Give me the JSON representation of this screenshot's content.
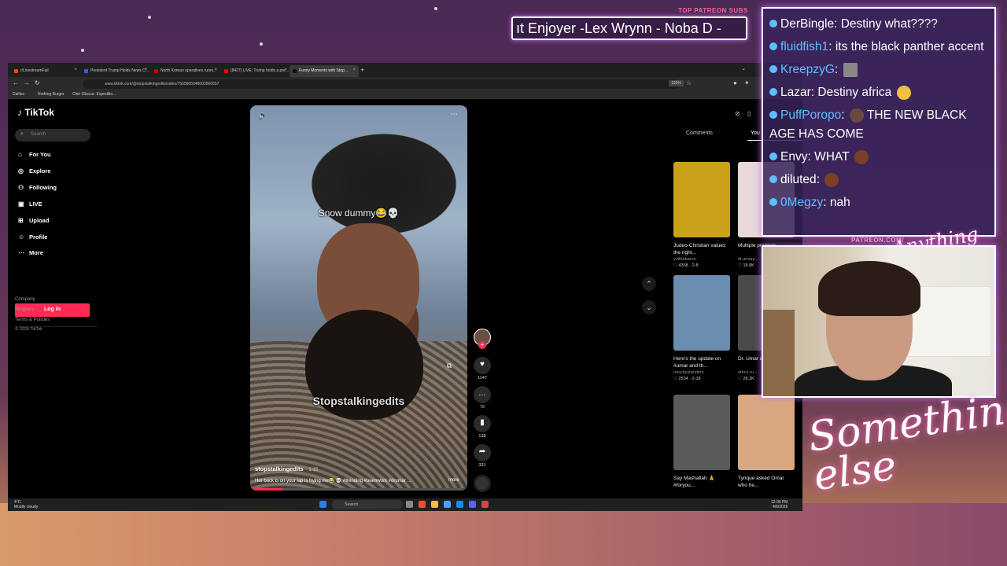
{
  "browser": {
    "tabs": [
      {
        "label": "r/LivestreamFail",
        "color": "#ff4500"
      },
      {
        "label": "President Trump Holds News C...",
        "color": "#3b5bdb"
      },
      {
        "label": "North Korean operatives runni...",
        "color": "#cc0000"
      },
      {
        "label": "(8427) LIVE: Trump holds a pre...",
        "color": "#ff0000"
      },
      {
        "label": "Funny Moments with Stop...",
        "color": "#111111"
      }
    ],
    "url": "www.tiktok.com/@stopstalkingedits/video/7555805646003560557",
    "zoom": "120%",
    "bookmarks": [
      "Dailies",
      "Nothing Burger",
      "Clair Obscur: Expeditio..."
    ]
  },
  "tiktok": {
    "logo": "TikTok",
    "search_placeholder": "Search",
    "nav": [
      {
        "label": "For You",
        "icon": "home-icon",
        "glyph": "⌂"
      },
      {
        "label": "Explore",
        "icon": "compass-icon",
        "glyph": "◎"
      },
      {
        "label": "Following",
        "icon": "people-icon",
        "glyph": "⚇"
      },
      {
        "label": "LIVE",
        "icon": "live-icon",
        "glyph": "▣"
      },
      {
        "label": "Upload",
        "icon": "upload-icon",
        "glyph": "⊞"
      },
      {
        "label": "Profile",
        "icon": "profile-icon",
        "glyph": "☺"
      },
      {
        "label": "More",
        "icon": "more-icon",
        "glyph": "⋯"
      }
    ],
    "login_label": "Log in",
    "footer": [
      "Company",
      "Program",
      "Terms & Policies",
      "© 2026 TikTok"
    ],
    "video": {
      "caption": "Snow dummy😂💀",
      "watermark": "Stopstalkingedits",
      "username": "stopstalkingedits",
      "date": "· 1-15",
      "description": "Her back is on your lap is frying me😂 💀 #trending #teamwork #drumar ...",
      "more_label": "more",
      "progress": 0.15
    },
    "actions": {
      "likes": "1147",
      "comments": "72",
      "saves": "138",
      "shares": "331"
    },
    "panel": {
      "tab_comments": "Comments",
      "tab_you": "You",
      "cards": [
        {
          "title": "Judeo-Christian values the right...",
          "user": "yulthebaron",
          "stats": "♡ 4358 · 2-8",
          "color": "#c9a21a"
        },
        {
          "title": "Multiple pregnan...",
          "user": "dr.umary...",
          "stats": "♡ 18.8K",
          "color": "#e8d8d8"
        },
        {
          "title": "Here's the update on #umar and th...",
          "user": "nosybystanders",
          "stats": "♡ 2534 · 2-18",
          "color": "#6b8db0"
        },
        {
          "title": "Dr. Umar don't ch...",
          "user": "africa.ru...",
          "stats": "♡ 28.3K",
          "color": "#4a4a4a"
        },
        {
          "title": "Say Mashallah 🙏 #foryou...",
          "user": "",
          "stats": "",
          "color": "#5a5a5a"
        },
        {
          "title": "Tyrique asked Omar who he...",
          "user": "",
          "stats": "",
          "color": "#d8a880"
        }
      ]
    }
  },
  "taskbar": {
    "weather_temp": "4°C",
    "weather_desc": "Mostly cloudy",
    "search": "Search",
    "time": "12:39 PM",
    "date": "4/6/2026"
  },
  "overlay": {
    "patreon_label": "TOP PATREON SUBS",
    "ticker": "ıt Enjoyer -Lex Wrynn -  Noba D -",
    "chat": [
      {
        "name": "DerBingle",
        "text": "Destiny what????",
        "white": true,
        "emote": ""
      },
      {
        "name": "fluidfish1",
        "text": "its the black panther accent",
        "white": false,
        "emote": ""
      },
      {
        "name": "KreepzyG",
        "text": "",
        "white": false,
        "emote": "#888888"
      },
      {
        "name": "Lazar",
        "text": "Destiny africa",
        "white": true,
        "emote": "#f0c040"
      },
      {
        "name": "PuffPoropo",
        "text": "THE NEW BLACK AGE HAS COME",
        "white": false,
        "emote": "#6a4a40"
      },
      {
        "name": "Envy",
        "text": "WHAT",
        "white": true,
        "emote": "#7a4028"
      },
      {
        "name": "diluted",
        "text": "",
        "white": true,
        "emote": "#7a4028"
      },
      {
        "name": "0Megzy",
        "text": "nah",
        "white": false,
        "emote": ""
      }
    ],
    "patreon_url": "PATREON.COM/",
    "brand_top": "Anything else",
    "brand_bottom": "Something else"
  }
}
